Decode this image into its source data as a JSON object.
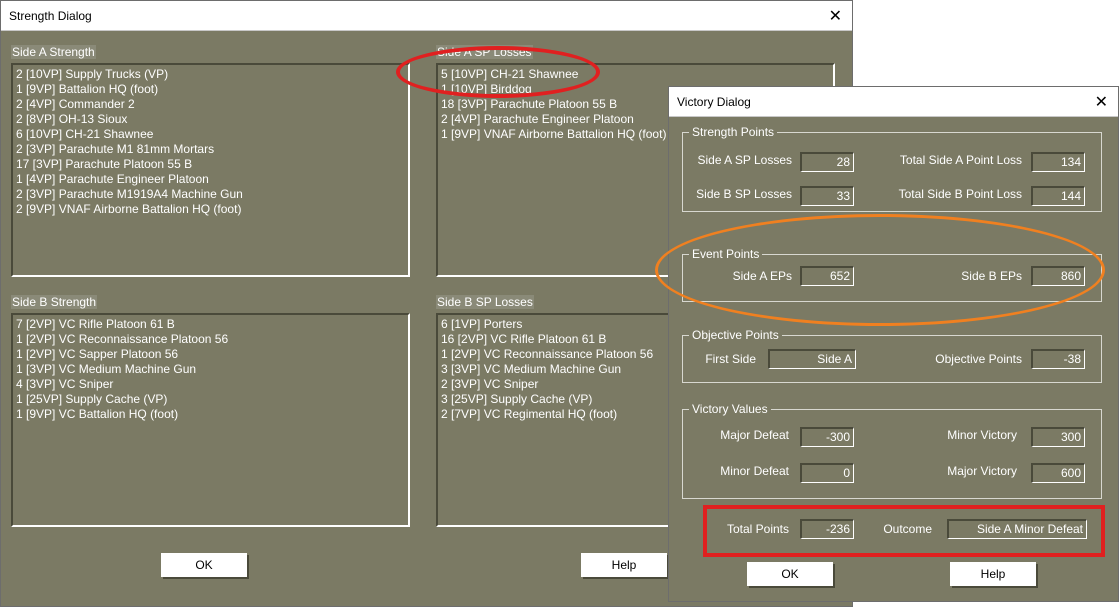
{
  "strength_dialog": {
    "title": "Strength Dialog",
    "close": "✕",
    "side_a_strength": {
      "label": "Side A Strength",
      "items": [
        "2 [10VP] Supply Trucks (VP)",
        "1 [9VP] Battalion HQ (foot)",
        "2 [4VP] Commander 2",
        "2 [8VP] OH-13 Sioux",
        "6 [10VP] CH-21 Shawnee",
        "2 [3VP] Parachute M1 81mm Mortars",
        "17 [3VP] Parachute Platoon 55 B",
        "1 [4VP] Parachute Engineer Platoon",
        "2 [3VP] Parachute M1919A4 Machine Gun",
        "2 [9VP] VNAF Airborne Battalion HQ (foot)"
      ]
    },
    "side_a_sp_losses": {
      "label": "Side A SP Losses",
      "items": [
        "5 [10VP] CH-21 Shawnee",
        "1 [10VP] Birddog",
        "18 [3VP] Parachute Platoon 55 B",
        "2 [4VP] Parachute Engineer Platoon",
        "1 [9VP] VNAF Airborne Battalion HQ (foot)"
      ]
    },
    "side_b_strength": {
      "label": "Side B Strength",
      "items": [
        "7 [2VP] VC Rifle Platoon 61 B",
        "1 [2VP] VC Reconnaissance Platoon 56",
        "1 [2VP] VC Sapper Platoon 56",
        "1 [3VP] VC Medium Machine Gun",
        "4 [3VP] VC Sniper",
        "1 [25VP] Supply Cache (VP)",
        "1 [9VP] VC Battalion HQ (foot)"
      ]
    },
    "side_b_sp_losses": {
      "label": "Side B SP Losses",
      "items": [
        "6 [1VP] Porters",
        "16 [2VP] VC Rifle Platoon 61 B",
        "1 [2VP] VC Reconnaissance Platoon 56",
        "3 [3VP] VC Medium Machine Gun",
        "2 [3VP] VC Sniper",
        "3 [25VP] Supply Cache (VP)",
        "2 [7VP] VC Regimental HQ (foot)"
      ]
    },
    "ok_label": "OK",
    "help_label": "Help"
  },
  "victory_dialog": {
    "title": "Victory Dialog",
    "close": "✕",
    "strength_points": {
      "title": "Strength Points",
      "side_a_sp_losses_label": "Side A SP Losses",
      "side_a_sp_losses": "28",
      "side_b_sp_losses_label": "Side B SP Losses",
      "side_b_sp_losses": "33",
      "total_a_label": "Total Side A Point Loss",
      "total_a": "134",
      "total_b_label": "Total Side B Point Loss",
      "total_b": "144"
    },
    "event_points": {
      "title": "Event Points",
      "side_a_label": "Side A EPs",
      "side_a": "652",
      "side_b_label": "Side B EPs",
      "side_b": "860"
    },
    "objective_points": {
      "title": "Objective Points",
      "first_side_label": "First Side",
      "first_side": "Side A",
      "objective_label": "Objective Points",
      "objective": "-38"
    },
    "victory_values": {
      "title": "Victory Values",
      "major_defeat_label": "Major Defeat",
      "major_defeat": "-300",
      "minor_defeat_label": "Minor Defeat",
      "minor_defeat": "0",
      "minor_victory_label": "Minor Victory",
      "minor_victory": "300",
      "major_victory_label": "Major Victory",
      "major_victory": "600"
    },
    "total_points_label": "Total Points",
    "total_points": "-236",
    "outcome_label": "Outcome",
    "outcome": "Side A Minor Defeat",
    "ok_label": "OK",
    "help_label": "Help"
  },
  "annotation_colors": {
    "red": "#e02020",
    "orange": "#f08020"
  }
}
